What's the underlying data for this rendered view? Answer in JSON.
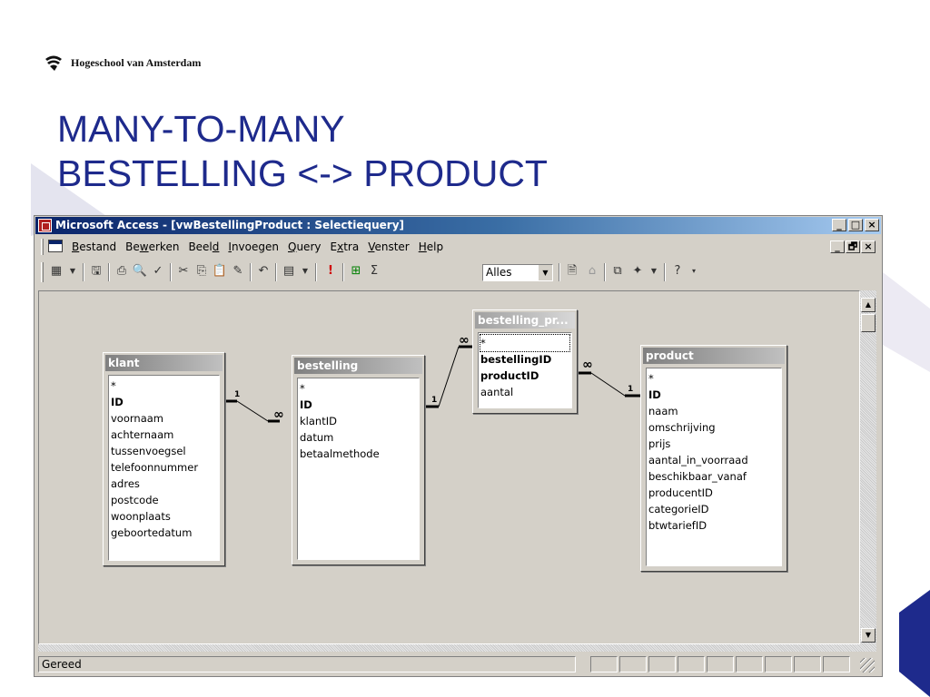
{
  "slide": {
    "logo_text": "Hogeschool van Amsterdam",
    "title_line1": "MANY-TO-MANY",
    "title_line2": "BESTELLING <-> PRODUCT"
  },
  "window": {
    "title": "Microsoft Access - [vwBestellingProduct : Selectiequery]",
    "caption_buttons": [
      "_",
      "□",
      "×"
    ],
    "mdi_buttons": [
      "_",
      "🗗",
      "×"
    ]
  },
  "menu": [
    {
      "label": "Bestand",
      "u": "B",
      "rest": "estand",
      "pre": ""
    },
    {
      "label": "Bewerken",
      "pre": "Be",
      "u": "w",
      "rest": "erken"
    },
    {
      "label": "Beeld",
      "pre": "Beel",
      "u": "d",
      "rest": ""
    },
    {
      "label": "Invoegen",
      "pre": "",
      "u": "I",
      "rest": "nvoegen"
    },
    {
      "label": "Query",
      "pre": "",
      "u": "Q",
      "rest": "uery"
    },
    {
      "label": "Extra",
      "pre": "E",
      "u": "x",
      "rest": "tra"
    },
    {
      "label": "Venster",
      "pre": "",
      "u": "V",
      "rest": "enster"
    },
    {
      "label": "Help",
      "pre": "",
      "u": "H",
      "rest": "elp"
    }
  ],
  "toolbar": {
    "combo_value": "Alles",
    "sigma": "Σ",
    "exclamation": "!"
  },
  "tables": [
    {
      "id": "klant",
      "title": "klant",
      "fields": [
        "*",
        "ID",
        "voornaam",
        "achternaam",
        "tussenvoegsel",
        "telefoonnummer",
        "adres",
        "postcode",
        "woonplaats",
        "geboortedatum"
      ],
      "keys": [
        "ID"
      ]
    },
    {
      "id": "bestelling",
      "title": "bestelling",
      "fields": [
        "*",
        "ID",
        "klantID",
        "datum",
        "betaalmethode"
      ],
      "keys": [
        "ID"
      ]
    },
    {
      "id": "bestelling_product",
      "title": "bestelling_pr...",
      "fields": [
        "*",
        "bestellingID",
        "productID",
        "aantal"
      ],
      "keys": [
        "bestellingID",
        "productID"
      ]
    },
    {
      "id": "product",
      "title": "product",
      "fields": [
        "*",
        "ID",
        "naam",
        "omschrijving",
        "prijs",
        "aantal_in_voorraad",
        "beschikbaar_vanaf",
        "producentID",
        "categorieID",
        "btwtariefID"
      ],
      "keys": [
        "ID"
      ]
    }
  ],
  "relationships": [
    {
      "from": "klant",
      "to": "bestelling",
      "from_label": "1",
      "to_label": "∞"
    },
    {
      "from": "bestelling",
      "to": "bestelling_product",
      "from_label": "1",
      "to_label": "∞"
    },
    {
      "from": "bestelling_product",
      "to": "product",
      "from_label": "∞",
      "to_label": "1"
    }
  ],
  "status": {
    "text": "Gereed"
  }
}
